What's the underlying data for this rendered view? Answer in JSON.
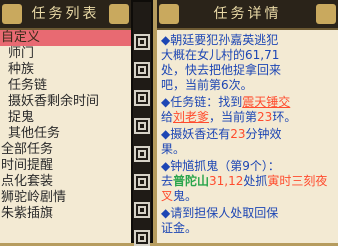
{
  "left_panel": {
    "title": "任务列表",
    "items": [
      {
        "label": "自定义",
        "selected": true,
        "indent": false
      },
      {
        "label": "师门",
        "selected": false,
        "indent": true
      },
      {
        "label": "种族",
        "selected": false,
        "indent": true
      },
      {
        "label": "任务链",
        "selected": false,
        "indent": true
      },
      {
        "label": "摄妖香剩余时间",
        "selected": false,
        "indent": true
      },
      {
        "label": "捉鬼",
        "selected": false,
        "indent": true
      },
      {
        "label": "其他任务",
        "selected": false,
        "indent": true
      },
      {
        "label": "全部任务",
        "selected": false,
        "indent": false
      },
      {
        "label": "时间提醒",
        "selected": false,
        "indent": false
      },
      {
        "label": "点化套装",
        "selected": false,
        "indent": false
      },
      {
        "label": "狮驼岭剧情",
        "selected": false,
        "indent": false
      },
      {
        "label": "朱紫插旗",
        "selected": false,
        "indent": false
      }
    ]
  },
  "right_panel": {
    "title": "任务详情",
    "lines": {
      "p1a": "◆朝廷要犯孙嘉英逃犯",
      "p1b": "大概在女儿村的61,71",
      "p1c": "处，快去把他捉拿回来",
      "p1d": "吧，当前第6次。",
      "p2a": "◆任务链：找到",
      "p2b": "震天锤交",
      "p2c": "给",
      "p2d": "刘老爹",
      "p2e": "，当前第",
      "p2f": "23",
      "p2g": "环。",
      "p3a": "◆摄妖香还有",
      "p3b": "23",
      "p3c": "分钟效",
      "p3d": "果。",
      "p4a": "◆钟馗抓鬼（第9个）：",
      "p4b": "去",
      "p4c": "普陀山",
      "p4d": "31,12",
      "p4e": "处抓",
      "p4f": "寅时三刻夜叉",
      "p4g": "鬼。",
      "p5a": "◆请到担保人处取回保",
      "p5b": "证金。"
    }
  },
  "colors": {
    "background": "#b69c5e",
    "panel": "#f3ead3",
    "title_bar": "#2a2319",
    "selected_row": "#e86a72",
    "blue_text": "#1d46b4",
    "red_text": "#ff4c2e",
    "green_text": "#2aa54c"
  }
}
